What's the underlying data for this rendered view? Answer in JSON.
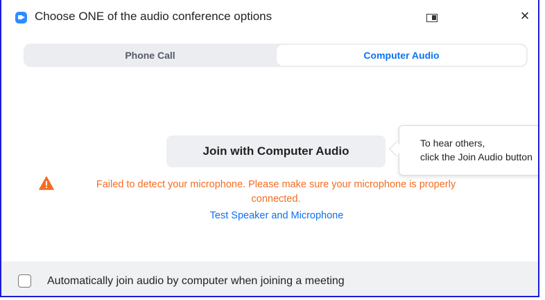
{
  "window": {
    "title": "Choose ONE of the audio conference options"
  },
  "titlebar_icons": {
    "app": "zoom-app-icon",
    "pip": "picture-in-picture-icon",
    "close": "×"
  },
  "tabs": [
    {
      "label": "Phone Call",
      "selected": false
    },
    {
      "label": "Computer Audio",
      "selected": true
    }
  ],
  "join_button": {
    "label": "Join with Computer Audio"
  },
  "tooltip": {
    "line1": "To hear others,",
    "line2": "click the Join Audio button"
  },
  "warning": {
    "icon": "warning-triangle-icon",
    "message": "Failed to detect your microphone. Please make sure your microphone is properly connected."
  },
  "test_link": {
    "label": "Test Speaker and Microphone"
  },
  "footer": {
    "checkbox_checked": false,
    "checkbox_label": "Automatically join audio by computer when joining a meeting"
  },
  "colors": {
    "accent": "#0e72ed",
    "warning": "#f26d21",
    "window_border": "#1b1bd8"
  }
}
